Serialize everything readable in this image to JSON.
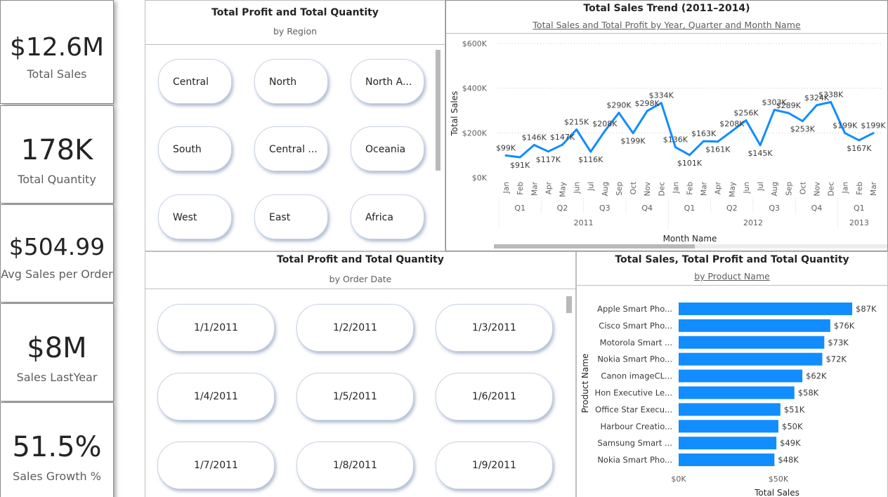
{
  "kpis": [
    {
      "value": "$12.6M",
      "label": "Total Sales"
    },
    {
      "value": "178K",
      "label": "Total Quantity"
    },
    {
      "value": "$504.99",
      "label": "Avg Sales per Order"
    },
    {
      "value": "$8M",
      "label": "Sales LastYear"
    },
    {
      "value": "51.5%",
      "label": "Sales Growth %"
    }
  ],
  "region_slicer": {
    "title": "Total Profit and Total Quantity",
    "subtitle": "by Region",
    "items": [
      "Central",
      "North",
      "North A...",
      "South",
      "Central ...",
      "Oceania",
      "West",
      "East",
      "Africa"
    ]
  },
  "date_slicer": {
    "title": "Total Profit and Total Quantity",
    "subtitle": "by Order Date",
    "items": [
      "1/1/2011",
      "1/2/2011",
      "1/3/2011",
      "1/4/2011",
      "1/5/2011",
      "1/6/2011",
      "1/7/2011",
      "1/8/2011",
      "1/9/2011"
    ]
  },
  "trend_chart": {
    "title": "Total Sales Trend (2011–2014)",
    "subtitle": "Total Sales and Total Profit by Year, Quarter and Month Name"
  },
  "product_chart": {
    "title": "Total Sales, Total Profit and Total Quantity",
    "subtitle": "by Product Name"
  },
  "chart_data": [
    {
      "type": "line",
      "ylabel": "Total Sales",
      "xlabel": "Month Name",
      "y_ticks": [
        "$0K",
        "$200K",
        "$400K",
        "$600K"
      ],
      "ylim": [
        0,
        600
      ],
      "grid": true,
      "months": [
        "Jan",
        "Feb",
        "Mar",
        "Apr",
        "May",
        "Jun",
        "Jul",
        "Aug",
        "Sep",
        "Oct",
        "Nov",
        "Dec",
        "Jan",
        "Feb",
        "Mar",
        "Apr",
        "May",
        "Jun",
        "Jul",
        "Aug",
        "Sep",
        "Oct",
        "Nov",
        "Dec",
        "Jan",
        "Feb",
        "Mar"
      ],
      "quarters": [
        "Q1",
        "Q2",
        "Q3",
        "Q4",
        "Q1",
        "Q2",
        "Q3",
        "Q4",
        "Q1"
      ],
      "years": [
        "2011",
        "2012",
        "2013"
      ],
      "values": [
        99,
        91,
        146,
        117,
        147,
        215,
        116,
        208,
        290,
        199,
        298,
        334,
        136,
        101,
        163,
        161,
        208,
        256,
        145,
        303,
        289,
        253,
        324,
        338,
        199,
        167,
        199
      ],
      "labels": [
        "$99K",
        "$91K",
        "$146K",
        "$117K",
        "$147K",
        "$215K",
        "$116K",
        "$208K",
        "$290K",
        "$199K",
        "$298K",
        "$334K",
        "$136K",
        "$101K",
        "$163K",
        "$161K",
        "$208K",
        "$256K",
        "$145K",
        "$303K",
        "$289K",
        "$253K",
        "$324K",
        "$338K",
        "$199K",
        "$167K",
        "$199K"
      ],
      "line_color": "#118DFF"
    },
    {
      "type": "bar",
      "orientation": "horizontal",
      "ylabel": "Product Name",
      "xlabel": "Total Sales",
      "x_ticks": [
        "$0K",
        "$50K"
      ],
      "xlim": [
        0,
        100
      ],
      "categories": [
        "Apple Smart Pho...",
        "Cisco Smart Pho...",
        "Motorola Smart ...",
        "Nokia Smart Pho...",
        "Canon imageCL...",
        "Hon Executive Le...",
        "Office Star Execu...",
        "Harbour Creatio...",
        "Samsung Smart ...",
        "Nokia Smart Pho..."
      ],
      "values": [
        87,
        76,
        73,
        72,
        62,
        58,
        51,
        50,
        49,
        48
      ],
      "labels": [
        "$87K",
        "$76K",
        "$73K",
        "$72K",
        "$62K",
        "$58K",
        "$51K",
        "$50K",
        "$49K",
        "$48K"
      ],
      "bar_color": "#118DFF"
    }
  ]
}
